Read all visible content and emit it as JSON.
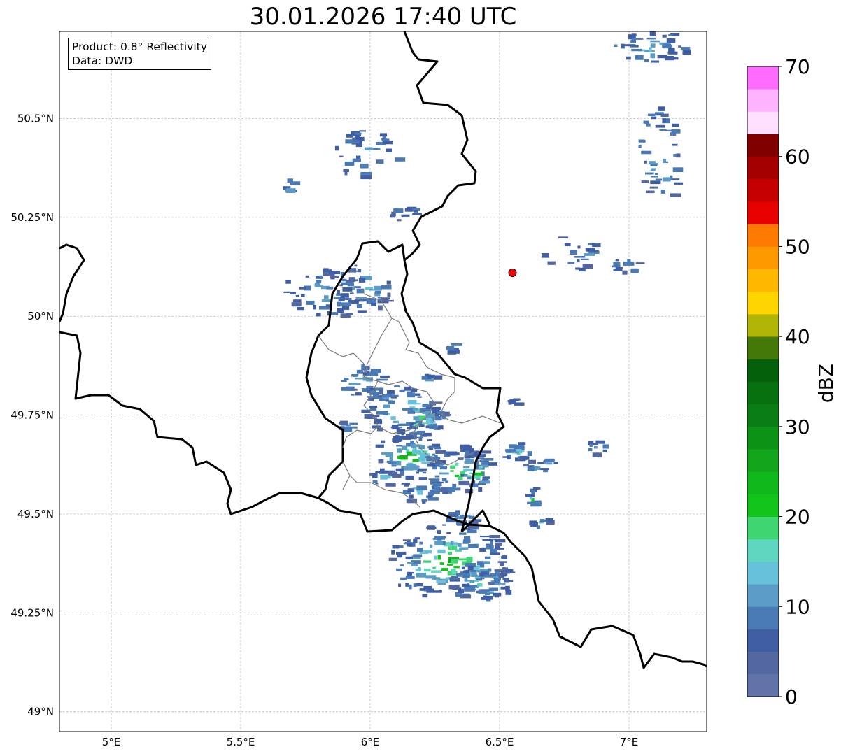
{
  "title": "30.01.2026 17:40 UTC",
  "infobox": {
    "product": "Product: 0.8° Reflectivity",
    "data": "Data: DWD"
  },
  "map": {
    "extent": {
      "lon": [
        4.8,
        7.3
      ],
      "lat": [
        48.95,
        50.72
      ]
    },
    "lon_ticks": [
      {
        "value": 5.0,
        "label": "5°E"
      },
      {
        "value": 5.5,
        "label": "5.5°E"
      },
      {
        "value": 6.0,
        "label": "6°E"
      },
      {
        "value": 6.5,
        "label": "6.5°E"
      },
      {
        "value": 7.0,
        "label": "7°E"
      }
    ],
    "lat_ticks": [
      {
        "value": 50.5,
        "label": "50.5°N"
      },
      {
        "value": 50.25,
        "label": "50.25°N"
      },
      {
        "value": 50.0,
        "label": "50°N"
      },
      {
        "value": 49.75,
        "label": "49.75°N"
      },
      {
        "value": 49.5,
        "label": "49.5°N"
      },
      {
        "value": 49.25,
        "label": "49.25°N"
      },
      {
        "value": 49.0,
        "label": "49°N"
      }
    ],
    "gridlines": true,
    "radar_site": {
      "lon": 6.55,
      "lat": 50.11,
      "color": "#ff0000"
    }
  },
  "colorbar": {
    "label": "dBZ",
    "min": 0,
    "max": 70,
    "step": 2.5,
    "tick_labels": [
      "0",
      "10",
      "20",
      "30",
      "40",
      "50",
      "60",
      "70"
    ],
    "colors": [
      "#6173a8",
      "#5368a1",
      "#3f5ea3",
      "#4a7ab3",
      "#5a9cc6",
      "#66c2d9",
      "#5ed6c0",
      "#3dd670",
      "#12c41a",
      "#10b81c",
      "#12a41a",
      "#0c9316",
      "#0a7e14",
      "#07700f",
      "#05600c",
      "#44790a",
      "#b0b404",
      "#ffd500",
      "#ffb700",
      "#ff9900",
      "#ff7a00",
      "#e80000",
      "#c60000",
      "#a50000",
      "#800000",
      "#ffe1ff",
      "#ffb3ff",
      "#ff6cff",
      "#e838ec"
    ]
  }
}
